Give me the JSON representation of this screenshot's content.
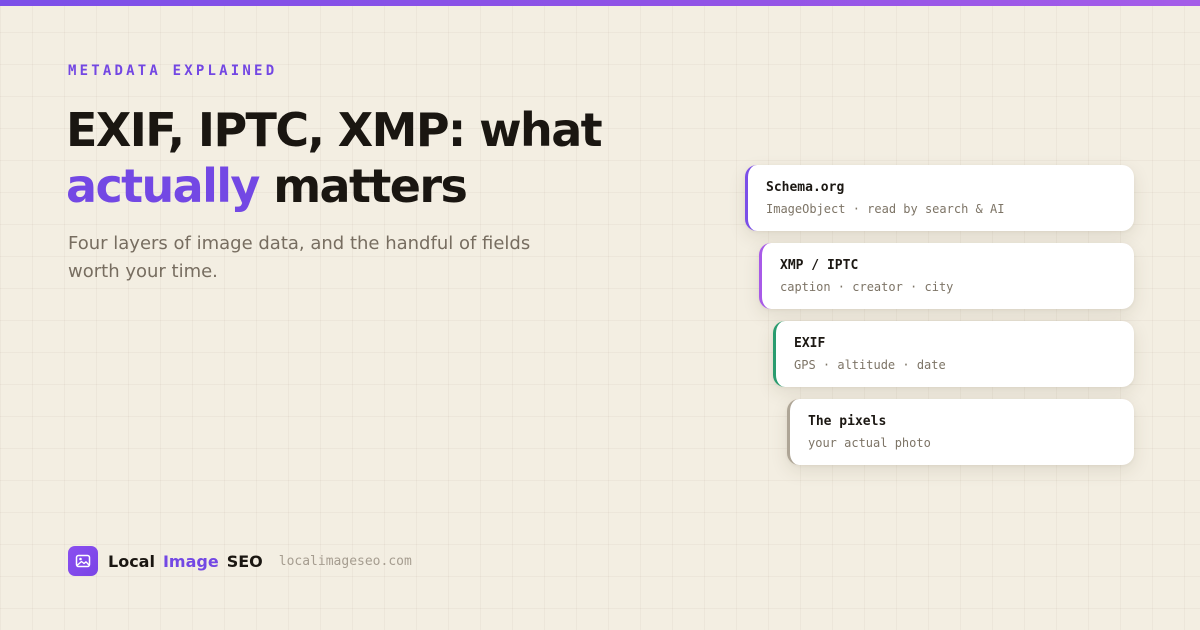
{
  "eyebrow": "METADATA EXPLAINED",
  "headline": {
    "line1": "EXIF, IPTC, XMP: what",
    "line2_accent": "actually",
    "line2_rest": " matters"
  },
  "subtitle": "Four layers of image data, and the handful of fields worth your time.",
  "layers": [
    {
      "title": "Schema.org",
      "subtitle": "ImageObject · read by search & AI",
      "color": "#7b4fe8"
    },
    {
      "title": "XMP / IPTC",
      "subtitle": "caption · creator · city",
      "color": "#a85ae8"
    },
    {
      "title": "EXIF",
      "subtitle": "GPS · altitude · date",
      "color": "#2a9c6f"
    },
    {
      "title": "The pixels",
      "subtitle": "your actual photo",
      "color": "#aea596"
    }
  ],
  "footer": {
    "brand_word1": "Local",
    "brand_word2": "Image",
    "brand_word3": "SEO",
    "domain": "localimageseo.com",
    "logo_icon": "image-icon"
  },
  "colors": {
    "accent": "#7348e4",
    "background": "#f3eee2"
  }
}
